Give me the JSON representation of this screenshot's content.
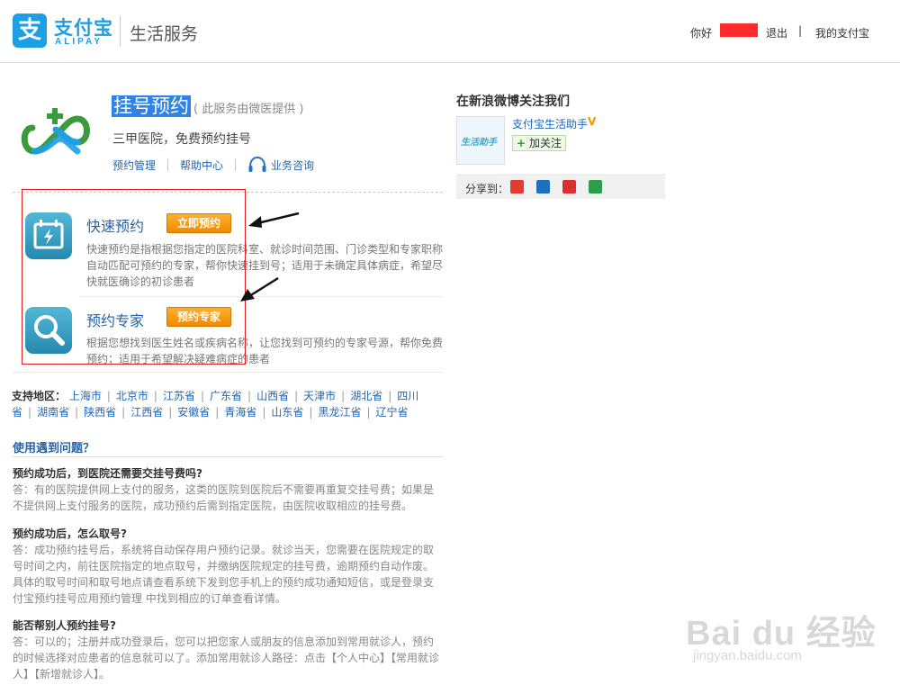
{
  "header": {
    "logo_char": "支",
    "logo_text": "支付宝",
    "logo_sub": "ALIPAY",
    "service_title": "生活服务",
    "hello": "你好",
    "logout": "退出",
    "separator": "|",
    "my_alipay": "我的支付宝"
  },
  "product": {
    "title": "挂号预约",
    "provider": "( 此服务由微医提供 )",
    "desc": "三甲医院，免费预约挂号",
    "links": [
      "预约管理",
      "帮助中心",
      "业务咨询"
    ]
  },
  "options": [
    {
      "title": "快速预约",
      "button": "立即预约",
      "desc": "快速预约是指根据您指定的医院科室、就诊时间范围、门诊类型和专家职称自动匹配可预约的专家，帮你快速挂到号；适用于未确定具体病症，希望尽快就医确诊的初诊患者"
    },
    {
      "title": "预约专家",
      "button": "预约专家",
      "desc": "根据您想找到医生姓名或疾病名称，让您找到可预约的专家号源，帮你免费预约；适用于希望解决疑难病症的患者"
    }
  ],
  "regions": {
    "label": "支持地区：",
    "items": [
      "上海市",
      "北京市",
      "江苏省",
      "广东省",
      "山西省",
      "天津市",
      "湖北省",
      "四川省",
      "湖南省",
      "陕西省",
      "江西省",
      "安徽省",
      "青海省",
      "山东省",
      "黑龙江省",
      "辽宁省"
    ]
  },
  "faq": {
    "title": "使用遇到问题？",
    "items": [
      {
        "q": "预约成功后，到医院还需要交挂号费吗?",
        "a": "答：有的医院提供网上支付的服务，这类的医院到医院后不需要再重复交挂号费；如果是不提供网上支付服务的医院，成功预约后需到指定医院，由医院收取相应的挂号费。"
      },
      {
        "q": "预约成功后，怎么取号?",
        "a": "答：成功预约挂号后，系统将自动保存用户预约记录。就诊当天，您需要在医院规定的取号时间之内，前往医院指定的地点取号，并缴纳医院规定的挂号费，逾期预约自动作废。具体的取号时间和取号地点请查看系统下发到您手机上的预约成功通知短信，或是登录支付宝预约挂号应用预约管理 中找到相应的订单查看详情。"
      },
      {
        "q": "能否帮别人预约挂号?",
        "a": "答：可以的；注册并成功登录后，您可以把您家人或朋友的信息添加到常用就诊人，预约的时候选择对应患者的信息就可以了。添加常用就诊人路径：点击【个人中心】【常用就诊人】【新增就诊人】。"
      }
    ]
  },
  "weibo": {
    "title": "在新浪微博关注我们",
    "avatar_text": "生活助手",
    "name": "支付宝生活助手",
    "verified": "V",
    "follow_plus": "+",
    "follow": "加关注",
    "share_label": "分享到："
  },
  "watermark": {
    "brand": "Bai du 经验",
    "url": "jingyan.baidu.com"
  },
  "colors": {
    "accent": "#1d9fe6",
    "link": "#2066b7",
    "button": "#f08a00",
    "highlight_box": "#e02020"
  }
}
